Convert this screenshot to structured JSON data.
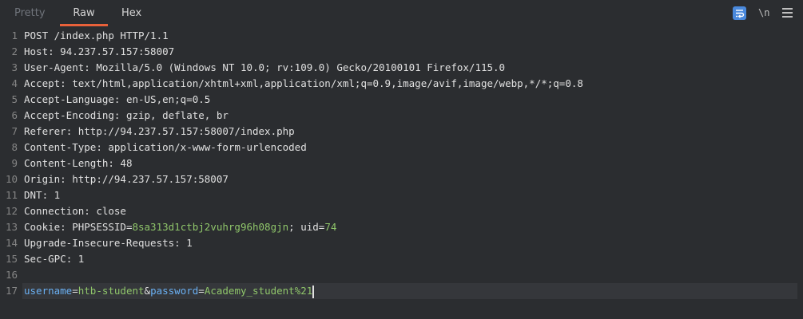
{
  "tabs": {
    "pretty": "Pretty",
    "raw": "Raw",
    "hex": "Hex"
  },
  "toolbar": {
    "newline_label": "\\n"
  },
  "colors": {
    "accent": "#e8613a",
    "wrap_button": "#4a89dc",
    "value_green": "#8fc56a",
    "param_blue": "#6ab0f3"
  },
  "icons": {
    "wrap": "wrap-lines-icon",
    "menu": "hamburger-menu-icon"
  },
  "request": {
    "request_line": "POST /index.php HTTP/1.1",
    "headers": [
      {
        "name": "Host",
        "value": "94.237.57.157:58007"
      },
      {
        "name": "User-Agent",
        "value": "Mozilla/5.0 (Windows NT 10.0; rv:109.0) Gecko/20100101 Firefox/115.0"
      },
      {
        "name": "Accept",
        "value": "text/html,application/xhtml+xml,application/xml;q=0.9,image/avif,image/webp,*/*;q=0.8"
      },
      {
        "name": "Accept-Language",
        "value": "en-US,en;q=0.5"
      },
      {
        "name": "Accept-Encoding",
        "value": "gzip, deflate, br"
      },
      {
        "name": "Referer",
        "value": "http://94.237.57.157:58007/index.php"
      },
      {
        "name": "Content-Type",
        "value": "application/x-www-form-urlencoded"
      },
      {
        "name": "Content-Length",
        "value": "48"
      },
      {
        "name": "Origin",
        "value": "http://94.237.57.157:58007"
      },
      {
        "name": "DNT",
        "value": "1"
      },
      {
        "name": "Connection",
        "value": "close"
      },
      {
        "name": "Cookie",
        "cookies": [
          {
            "key": "PHPSESSID",
            "value": "8sa313d1ctbj2vuhrg96h08gjn"
          },
          {
            "key": "uid",
            "value": "74"
          }
        ]
      },
      {
        "name": "Upgrade-Insecure-Requests",
        "value": "1"
      },
      {
        "name": "Sec-GPC",
        "value": "1"
      }
    ],
    "body_params": [
      {
        "key": "username",
        "value": "htb-student"
      },
      {
        "key": "password",
        "value": "Academy_student%21"
      }
    ]
  }
}
